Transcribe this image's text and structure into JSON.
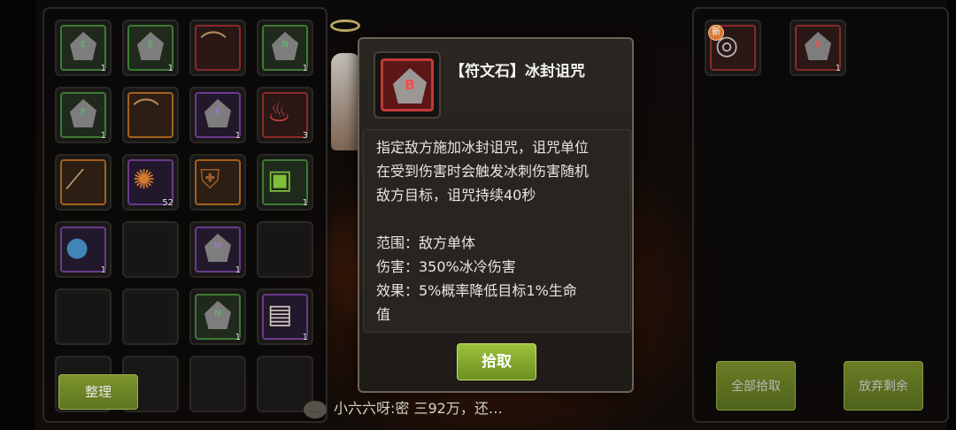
{
  "inventory": {
    "sort_label": "整理",
    "slots": [
      {
        "rarity": "green",
        "icon": "rune-stone-icon",
        "letter": "E",
        "count": "1"
      },
      {
        "rarity": "green",
        "icon": "rune-stone-icon",
        "letter": "E",
        "count": "1"
      },
      {
        "rarity": "red",
        "icon": "bow-icon",
        "count": ""
      },
      {
        "rarity": "green",
        "icon": "rune-stone-icon",
        "letter": "N",
        "count": "1"
      },
      {
        "rarity": "green",
        "icon": "rune-stone-icon",
        "letter": "E",
        "count": "1"
      },
      {
        "rarity": "orange",
        "icon": "bow-icon",
        "count": ""
      },
      {
        "rarity": "purple",
        "icon": "rune-stone-icon",
        "letter": "K",
        "count": "1"
      },
      {
        "rarity": "red",
        "icon": "potion-icon",
        "count": "3"
      },
      {
        "rarity": "orange",
        "icon": "staff-icon",
        "count": ""
      },
      {
        "rarity": "purple",
        "icon": "orb-icon",
        "count": "52"
      },
      {
        "rarity": "orange",
        "icon": "armor-icon",
        "count": ""
      },
      {
        "rarity": "green",
        "icon": "bag-icon",
        "count": "1"
      },
      {
        "rarity": "purple",
        "icon": "gem-icon",
        "count": "1"
      },
      {
        "rarity": "empty",
        "icon": "",
        "count": ""
      },
      {
        "rarity": "purple",
        "icon": "rune-stone-icon",
        "letter": "M",
        "count": "1"
      },
      {
        "rarity": "empty",
        "icon": "",
        "count": ""
      },
      {
        "rarity": "empty",
        "icon": "",
        "count": ""
      },
      {
        "rarity": "empty",
        "icon": "",
        "count": ""
      },
      {
        "rarity": "green",
        "icon": "rune-stone-icon",
        "letter": "N",
        "count": "1"
      },
      {
        "rarity": "purple",
        "icon": "scroll-icon",
        "count": "1"
      }
    ]
  },
  "tooltip": {
    "title": "【符文石】冰封诅咒",
    "icon_letter": "B",
    "desc_lines": [
      "指定敌方施加冰封诅咒，诅咒单位",
      "在受到伤害时会触发冰刺伤害随机",
      "敌方目标，诅咒持续40秒"
    ],
    "stat_lines": [
      "范围：敌方单体",
      "伤害：350%冰冷伤害",
      "效果：5%概率降低目标1%生命",
      "值"
    ],
    "pickup_label": "拾取"
  },
  "loot": {
    "items": [
      {
        "rarity": "red",
        "icon": "necklace-icon",
        "badge": "新",
        "count": ""
      },
      {
        "rarity": "red",
        "icon": "rune-stone-icon",
        "letter": "B",
        "count": "1"
      }
    ],
    "take_all_label": "全部拾取",
    "discard_rest_label": "放弃剩余"
  },
  "chat": {
    "icon": "chat-bubble-icon",
    "message": "小六六呀:密 三92万，还…"
  },
  "colors": {
    "accent_green": "#8eb334",
    "rarity_green": "#3d7a35",
    "rarity_red": "#c23a35",
    "rarity_purple": "#6a3a8e",
    "rarity_orange": "#a5601e"
  }
}
